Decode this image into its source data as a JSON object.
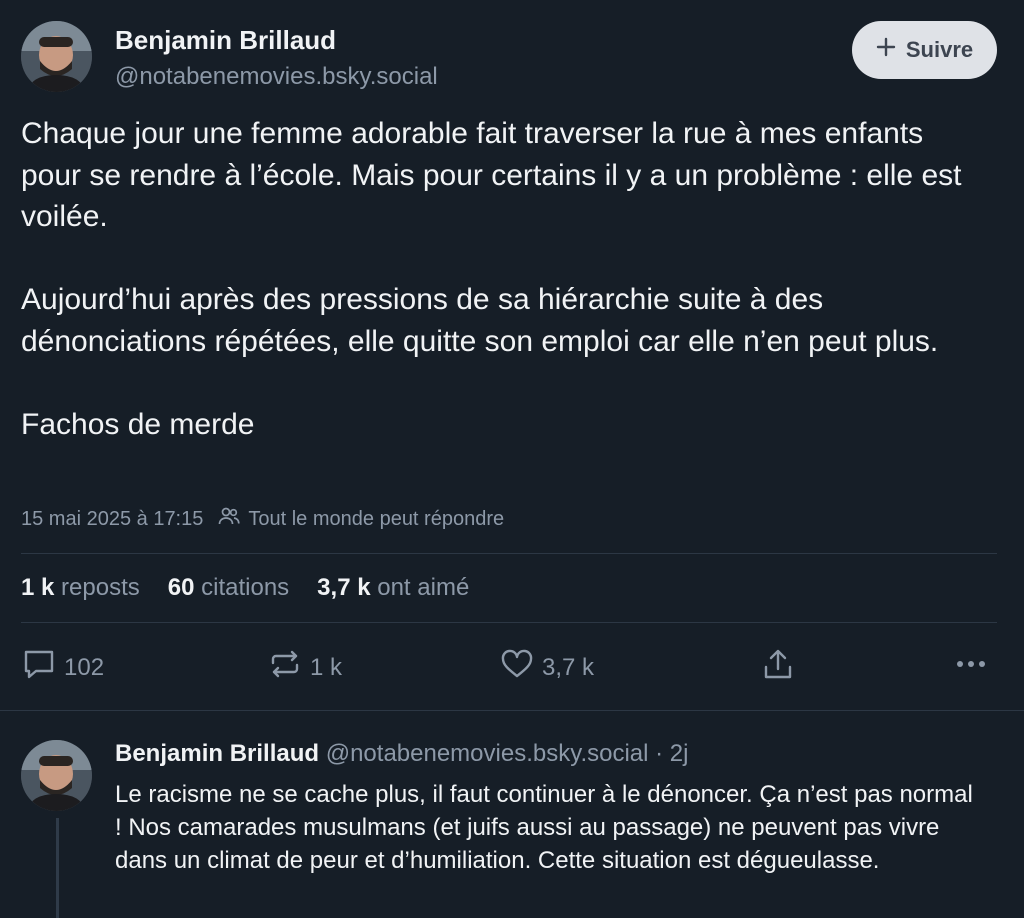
{
  "post": {
    "author_name": "Benjamin Brillaud",
    "author_handle": "@notabenemovies.bsky.social",
    "follow_label": "Suivre",
    "paragraphs": [
      "Chaque jour une femme adorable fait traverser la rue à mes enfants pour se rendre à l’école. Mais pour certains il y a un problème : elle est voilée.",
      "Aujourd’hui après des pressions de sa hiérarchie suite à des dénonciations répétées, elle quitte son emploi car elle n’en peut plus.",
      "Fachos de merde"
    ],
    "timestamp": "15 mai 2025 à 17:15",
    "reply_setting": "Tout le monde peut répondre",
    "stats": {
      "reposts_count": "1 k",
      "reposts_label": "reposts",
      "quotes_count": "60",
      "quotes_label": "citations",
      "likes_count": "3,7 k",
      "likes_label": "ont aimé"
    },
    "actions": {
      "reply_count": "102",
      "repost_count": "1 k",
      "like_count": "3,7 k"
    }
  },
  "reply": {
    "author_name": "Benjamin Brillaud",
    "author_handle": "@notabenemovies.bsky.social",
    "age": "· 2j",
    "text": "Le racisme ne se cache plus, il faut continuer à le dénoncer. Ça n’est pas normal ! Nos camarades musulmans (et juifs aussi au passage) ne peuvent pas vivre dans un climat de peur et d’humiliation. Cette situation est dégueulasse."
  },
  "icons": {
    "plus": "plus-icon",
    "people": "people-icon",
    "reply": "comment-icon",
    "repost": "repost-icon",
    "like": "heart-icon",
    "share": "share-icon",
    "more": "ellipsis-icon"
  },
  "colors": {
    "background": "#161e27",
    "text": "#f1f3f5",
    "muted": "#8d99a8",
    "divider": "#2c3744",
    "button_bg": "#dfe2e7"
  }
}
